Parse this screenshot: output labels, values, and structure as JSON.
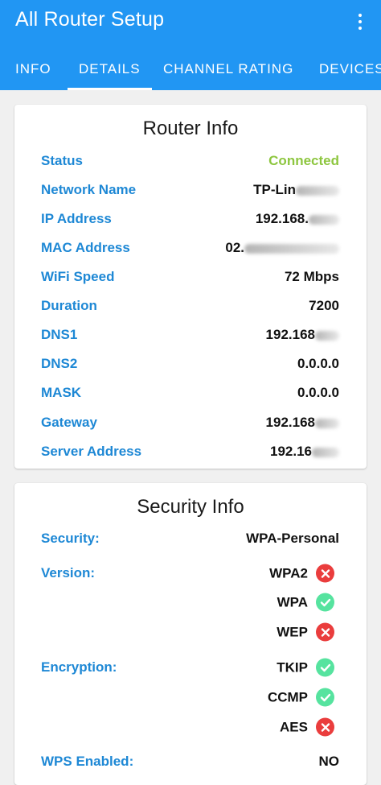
{
  "app": {
    "title": "All Router Setup",
    "menu_icon": "more-vert-icon"
  },
  "tabs": [
    {
      "label": "INFO"
    },
    {
      "label": "DETAILS",
      "active": true
    },
    {
      "label": "CHANNEL RATING"
    },
    {
      "label": "DEVICES"
    }
  ],
  "router_info": {
    "title": "Router Info",
    "rows": [
      {
        "label": "Status",
        "value": "Connected"
      },
      {
        "label": "Network Name",
        "value": "TP-Lin"
      },
      {
        "label": "IP Address",
        "value": "192.168."
      },
      {
        "label": "MAC Address",
        "value": "02."
      },
      {
        "label": "WiFi Speed",
        "value": "72 Mbps"
      },
      {
        "label": "Duration",
        "value": "7200"
      },
      {
        "label": "DNS1",
        "value": "192.168"
      },
      {
        "label": "DNS2",
        "value": "0.0.0.0"
      },
      {
        "label": "MASK",
        "value": "0.0.0.0"
      },
      {
        "label": "Gateway",
        "value": "192.168"
      },
      {
        "label": "Server Address",
        "value": "192.16"
      }
    ]
  },
  "security_info": {
    "title": "Security Info",
    "security_label": "Security:",
    "security_value": "WPA-Personal",
    "version_label": "Version:",
    "versions": [
      {
        "name": "WPA2",
        "supported": false
      },
      {
        "name": "WPA",
        "supported": true
      },
      {
        "name": "WEP",
        "supported": false
      }
    ],
    "encryption_label": "Encryption:",
    "encryptions": [
      {
        "name": "TKIP",
        "supported": true
      },
      {
        "name": "CCMP",
        "supported": true
      },
      {
        "name": "AES",
        "supported": false
      }
    ],
    "wps_label": "WPS Enabled:",
    "wps_value": "NO"
  },
  "colors": {
    "appbar": "#2196f3",
    "label": "#1e88d5",
    "connected": "#8dc63f",
    "ok": "#56e39f",
    "fail": "#ea3d3d"
  }
}
